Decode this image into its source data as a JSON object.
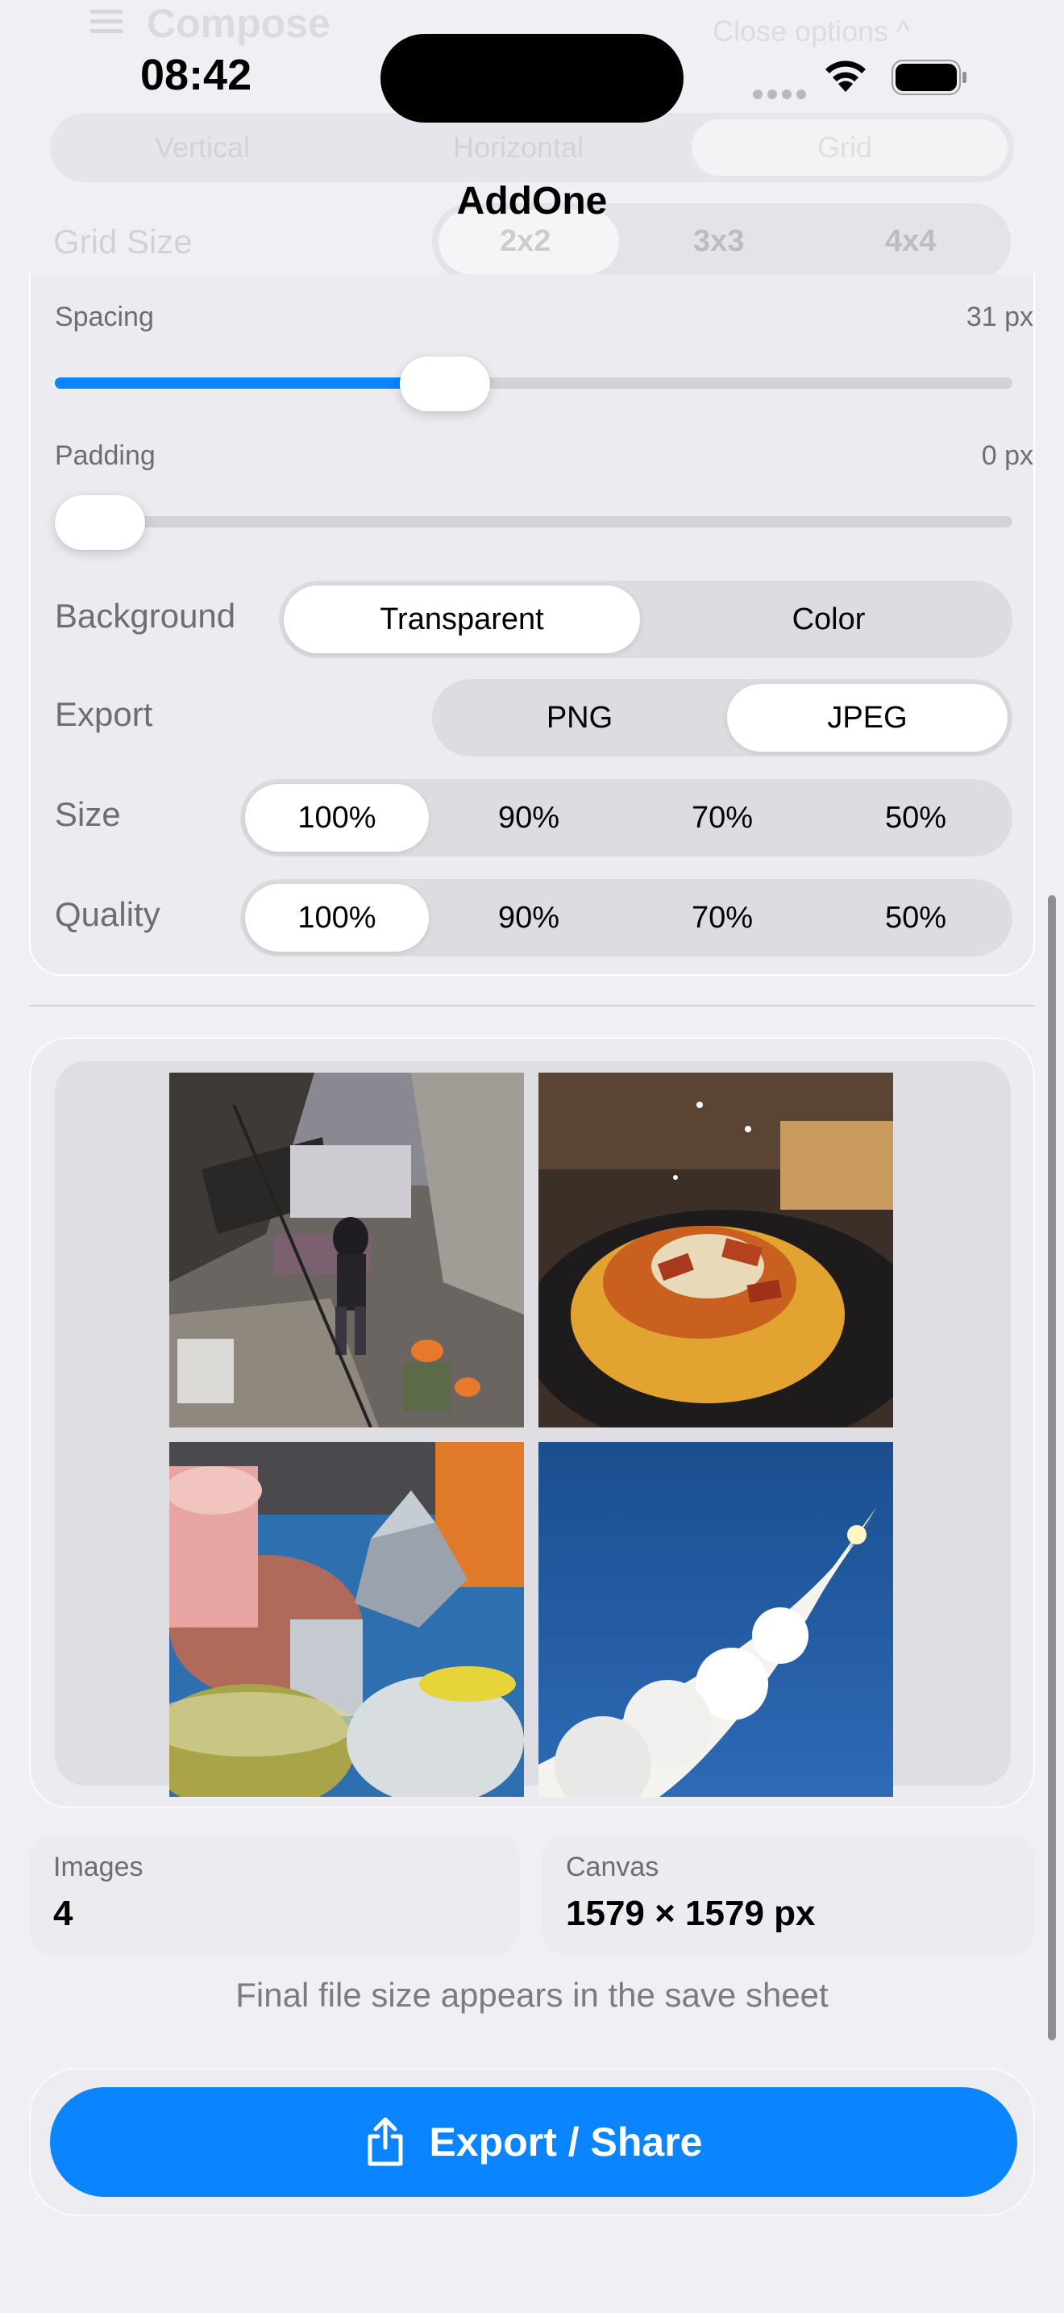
{
  "status_bar": {
    "time": "08:42"
  },
  "ghost_header": {
    "compose_label": "Compose",
    "close_options_label": "Close options ^",
    "layout_options": [
      "Vertical",
      "Horizontal",
      "Grid"
    ],
    "layout_selected": "Grid",
    "grid_size_label": "Grid Size",
    "grid_sizes": [
      "2x2",
      "3x3",
      "4x4"
    ],
    "grid_size_selected": "2x2"
  },
  "app": {
    "title": "AddOne"
  },
  "options": {
    "spacing": {
      "label": "Spacing",
      "value_text": "31 px",
      "value": 31,
      "fraction": 0.398
    },
    "padding": {
      "label": "Padding",
      "value_text": "0 px",
      "value": 0,
      "fraction": 0.0
    },
    "background": {
      "label": "Background",
      "options": [
        "Transparent",
        "Color"
      ],
      "selected": "Transparent"
    },
    "export": {
      "label": "Export",
      "options": [
        "PNG",
        "JPEG"
      ],
      "selected": "JPEG"
    },
    "size": {
      "label": "Size",
      "options": [
        "100%",
        "90%",
        "70%",
        "50%"
      ],
      "selected": "100%"
    },
    "quality": {
      "label": "Quality",
      "options": [
        "100%",
        "90%",
        "70%",
        "50%"
      ],
      "selected": "100%"
    }
  },
  "preview": {
    "tiles": [
      "collapsed-building-rescue",
      "pasta-carbonara",
      "drinks-and-moka-pot",
      "rocket-launch-smoke"
    ]
  },
  "stats": {
    "images": {
      "label": "Images",
      "value": "4"
    },
    "canvas": {
      "label": "Canvas",
      "value": "1579 × 1579 px"
    }
  },
  "hint": "Final file size appears in the save sheet",
  "export_button": {
    "label": "Export / Share",
    "icon": "share-icon"
  },
  "colors": {
    "accent": "#0a84ff",
    "background": "#f0f0f4",
    "card": "#ebebf0"
  }
}
